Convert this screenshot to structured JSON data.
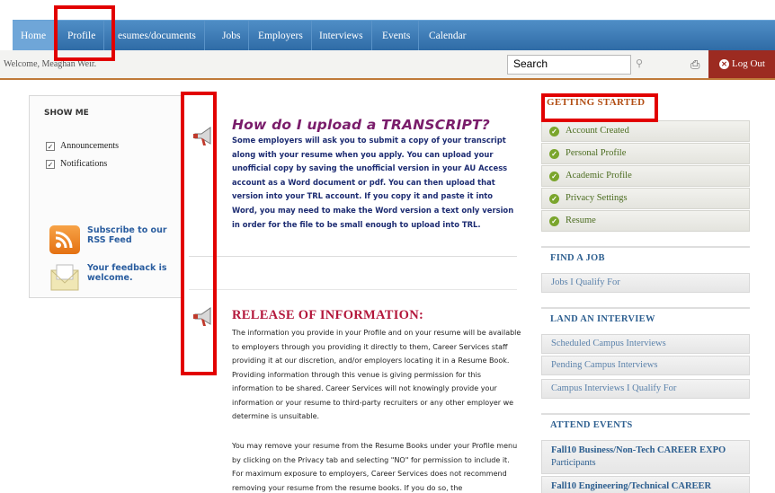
{
  "nav": {
    "items": [
      "Home",
      "Profile",
      "Resumes/documents",
      "Jobs",
      "Employers",
      "Interviews",
      "Events",
      "Calendar"
    ],
    "resumes_visible": "esumes/documents"
  },
  "header": {
    "welcome": "Welcome, Meaghan Weir.",
    "search_value": "Search",
    "logout": "Log Out"
  },
  "left": {
    "show_me": "SHOW ME",
    "filters": [
      "Announcements",
      "Notifications"
    ],
    "rss": "Subscribe to our RSS Feed",
    "feedback": "Your feedback is welcome."
  },
  "articles": {
    "a1_title": "How do I upload a TRANSCRIPT?",
    "a1_body": "Some employers will ask you to submit a copy of your transcript along with your resume when you apply. You can upload your unofficial copy by saving the unofficial version in your AU Access account as a Word document or pdf. You can then upload that version into your TRL account. If you copy it and paste it into Word, you may need to make the Word version a text only version in order for the file to be small enough to upload into TRL.",
    "a2_title": "RELEASE OF INFORMATION:",
    "a2_body": "The information you provide in your Profile and on your resume will be available to employers through you providing it directly to them, Career Services staff providing it at our discretion, and/or employers locating it in a Resume Book. Providing information through this venue is giving permission for this information to be shared. Career Services will not knowingly provide your information or your resume to third-party recruiters or any other employer we determine is unsuitable.",
    "a2_body2": "You may remove your resume from the Resume Books under your Profile menu by clicking on the Privacy tab and selecting \"NO\" for permission to include it. For maximum exposure to employers, Career Services does not recommend removing your resume from the resume books. If you do so, the"
  },
  "right": {
    "getting_started": "GETTING STARTED",
    "steps": [
      "Account Created",
      "Personal Profile",
      "Academic Profile",
      "Privacy Settings",
      "Resume"
    ],
    "find_job": "FIND A JOB",
    "find_job_links": [
      "Jobs I Qualify For"
    ],
    "land_interview": "LAND AN INTERVIEW",
    "interview_links": [
      "Scheduled Campus Interviews",
      "Pending Campus Interviews",
      "Campus Interviews I Qualify For"
    ],
    "attend_events": "ATTEND EVENTS",
    "event1_bold": "Fall10 Business/Non-Tech CAREER EXPO",
    "event1_light": "Participants",
    "event2_bold": "Fall10 Engineering/Technical CAREER"
  },
  "colors": {
    "nav_blue": "#2f6ba6",
    "highlight_red": "#e20000",
    "logout_red": "#9c2b21",
    "title_purple": "#7a1d6b",
    "title_crimson": "#b3173b",
    "gs_orange": "#b24e14"
  }
}
